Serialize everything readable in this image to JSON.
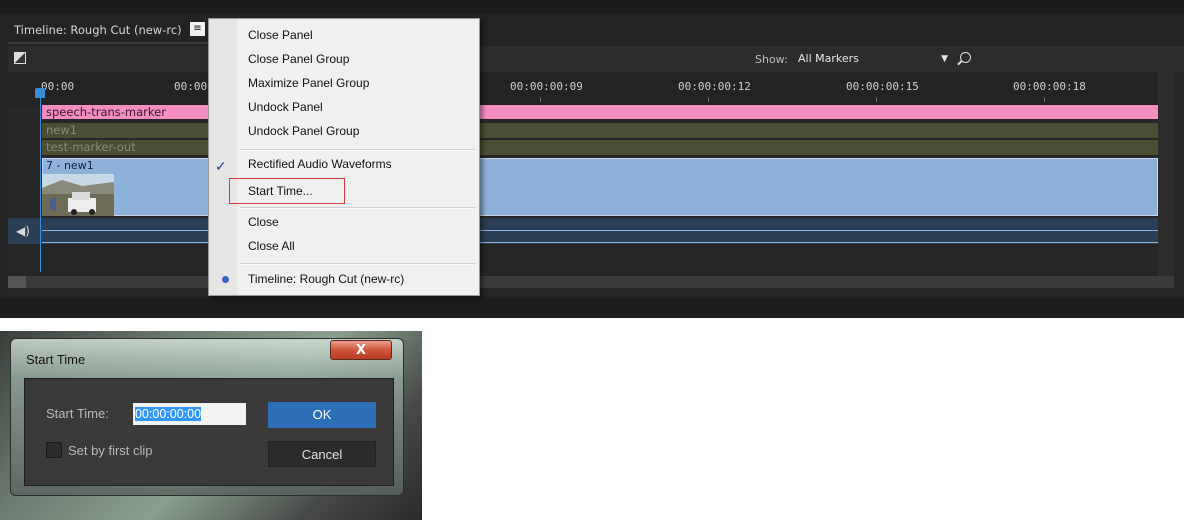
{
  "timeline": {
    "tab_title": "Timeline: Rough Cut (new-rc)",
    "tab_menu_glyph": "≡",
    "show_label": "Show:",
    "markers_selected": "All Markers",
    "timecodes": [
      "00:00",
      "00:00:",
      "00:00:00:09",
      "00:00:00:12",
      "00:00:00:15",
      "00:00:00:18"
    ],
    "markers": [
      "speech-trans-marker",
      "new1",
      "test-marker-out"
    ],
    "clip_label": "7 - new1",
    "colors": {
      "marker_pink": "#f48ec1",
      "marker_olive": "#4b4e32",
      "clip_blue": "#8db1d9",
      "playhead": "#3a8ed8"
    }
  },
  "context_menu": {
    "items": [
      "Close Panel",
      "Close Panel Group",
      "Maximize Panel Group",
      "Undock Panel",
      "Undock Panel Group",
      "Rectified Audio Waveforms",
      "Start Time...",
      "Close",
      "Close All",
      "Timeline: Rough Cut (new-rc)"
    ],
    "checked_item": "Rectified Audio Waveforms",
    "highlighted_item": "Start Time..."
  },
  "dialog": {
    "title": "Start Time",
    "close_glyph": "X",
    "start_time_label": "Start Time:",
    "start_time_value": "00:00:00:00",
    "ok_label": "OK",
    "cancel_label": "Cancel",
    "checkbox_label": "Set by first clip",
    "checkbox_checked": false
  }
}
